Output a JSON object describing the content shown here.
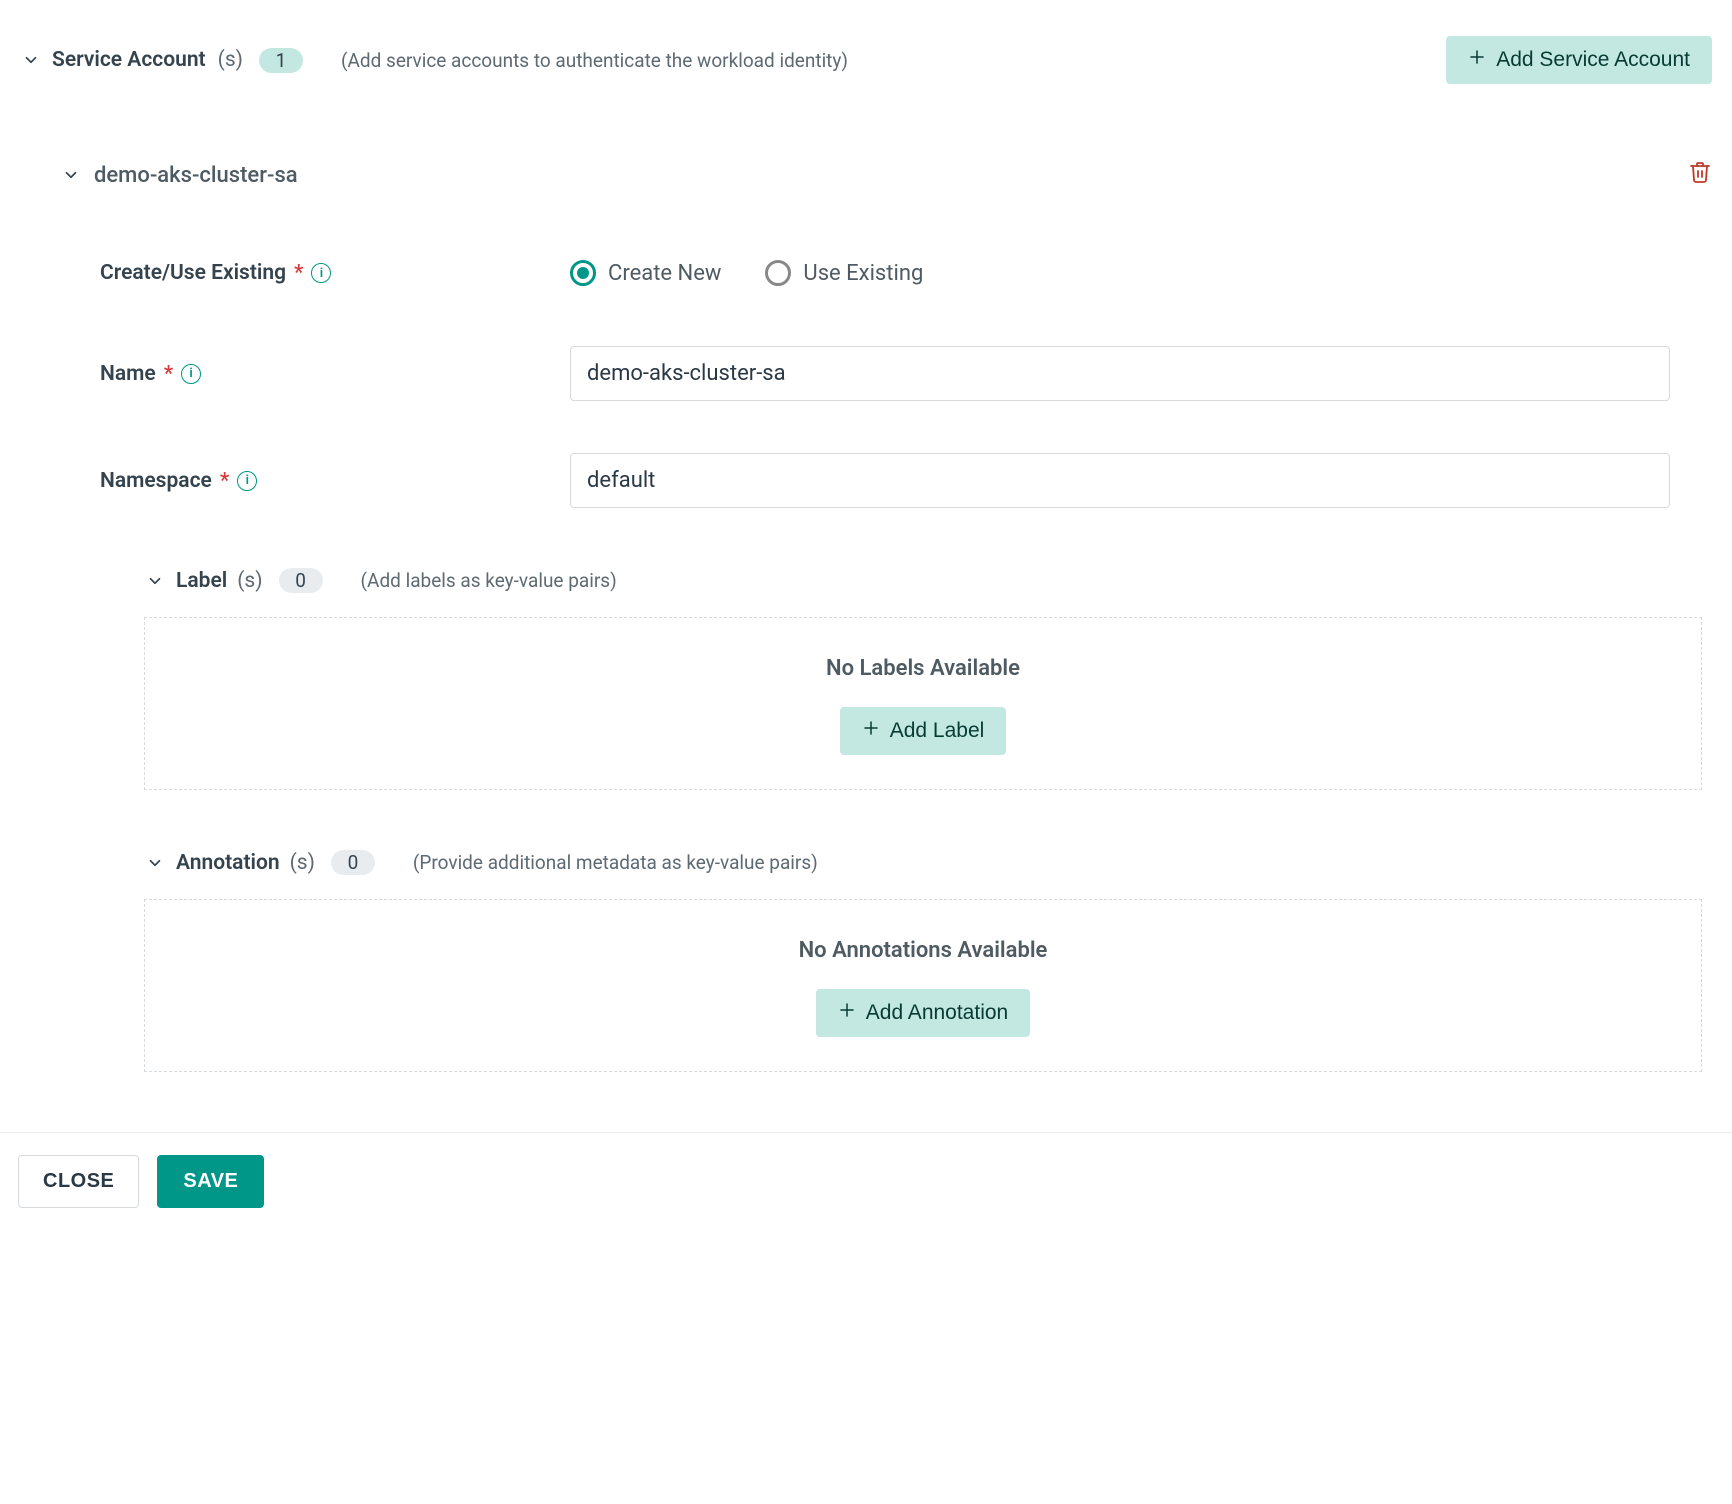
{
  "header": {
    "title": "Service Account",
    "suffix": "(s)",
    "count": "1",
    "hint": "(Add service accounts to authenticate the workload identity)",
    "add_button": "Add Service Account"
  },
  "item": {
    "name": "demo-aks-cluster-sa"
  },
  "form": {
    "create_label": "Create/Use Existing",
    "create_new": "Create New",
    "use_existing": "Use Existing",
    "name_label": "Name",
    "name_value": "demo-aks-cluster-sa",
    "namespace_label": "Namespace",
    "namespace_value": "default"
  },
  "labels_section": {
    "title": "Label",
    "suffix": "(s)",
    "count": "0",
    "hint": "(Add labels as key-value pairs)",
    "empty": "No Labels Available",
    "add_button": "Add Label"
  },
  "annotations_section": {
    "title": "Annotation",
    "suffix": "(s)",
    "count": "0",
    "hint": "(Provide additional metadata as key-value pairs)",
    "empty": "No Annotations Available",
    "add_button": "Add Annotation"
  },
  "footer": {
    "close": "CLOSE",
    "save": "SAVE"
  },
  "glyphs": {
    "info": "i",
    "required": "*"
  }
}
